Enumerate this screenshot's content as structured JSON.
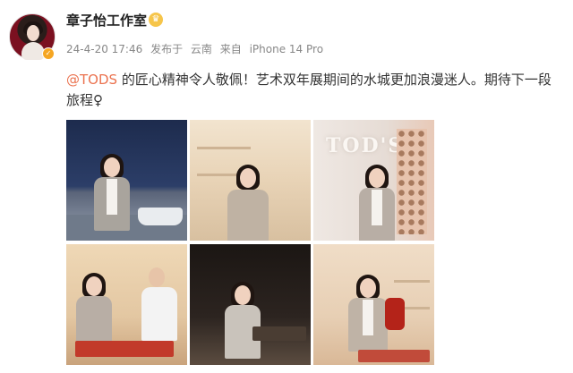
{
  "user": {
    "name": "章子怡工作室",
    "avatar_icon": "avatar-photo",
    "verify_icon": "verified-badge-icon",
    "vip_icon": "vip-crown-icon"
  },
  "meta": {
    "time": "24-4-20 17:46",
    "location_prefix": "发布于",
    "location": "云南",
    "device_prefix": "来自",
    "device": "iPhone 14 Pro"
  },
  "post": {
    "mention": "@TODS",
    "text_line1": " 的匠心精神令人敬佩！艺术双年展期间的水城更加浪漫迷人。期待下一段",
    "text_line2": "旅程",
    "emoji": "♀"
  },
  "photos": {
    "photo3_sign": "TOD'S",
    "images": [
      {
        "desc": "photo-1"
      },
      {
        "desc": "photo-2"
      },
      {
        "desc": "photo-3"
      },
      {
        "desc": "photo-4"
      },
      {
        "desc": "photo-5"
      },
      {
        "desc": "photo-6"
      }
    ]
  },
  "colors": {
    "mention": "#eb7350",
    "meta": "#888888",
    "badge": "#f5a623"
  }
}
